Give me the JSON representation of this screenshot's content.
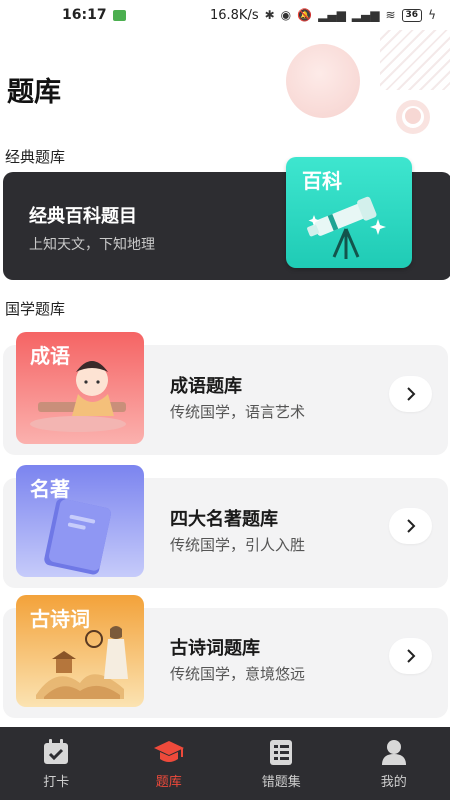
{
  "status_bar": {
    "time": "16:17",
    "speed": "16.8K/s",
    "battery": "36"
  },
  "page_title": "题库",
  "classic": {
    "section_label": "经典题库",
    "card_title": "经典百科题目",
    "card_subtitle": "上知天文，下知地理",
    "tile_label": "百科"
  },
  "guoxue": {
    "section_label": "国学题库",
    "items": [
      {
        "tile_label": "成语",
        "title": "成语题库",
        "subtitle": "传统国学，语言艺术"
      },
      {
        "tile_label": "名著",
        "title": "四大名著题库",
        "subtitle": "传统国学，引人入胜"
      },
      {
        "tile_label": "古诗词",
        "title": "古诗词题库",
        "subtitle": "传统国学，意境悠远"
      }
    ]
  },
  "bottom_nav": {
    "items": [
      {
        "label": "打卡",
        "icon": "calendar-check-icon"
      },
      {
        "label": "题库",
        "icon": "graduation-cap-icon"
      },
      {
        "label": "错题集",
        "icon": "list-book-icon"
      },
      {
        "label": "我的",
        "icon": "user-icon"
      }
    ],
    "active_index": 1
  },
  "colors": {
    "accent": "#ee4a3b",
    "dark_card": "#2d2d31",
    "baike_teal": "#2ad8c0",
    "chengyu_red": "#f25a5a",
    "mingzhu_blue": "#7d86f0",
    "gushi_orange": "#f3a63a"
  }
}
